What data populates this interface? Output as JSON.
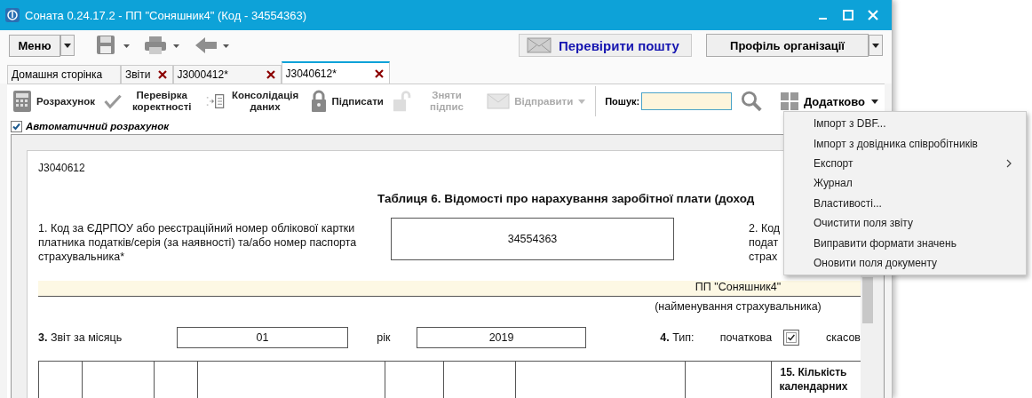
{
  "window": {
    "title": "Соната 0.24.17.2 - ПП \"Соняшник4\" (Код - 34554363)"
  },
  "toolbar": {
    "menu_button": "Меню",
    "mail_button": "Перевірити пошту",
    "profile_button": "Профіль організації"
  },
  "tabs": [
    {
      "label": "Домашня сторінка",
      "selected": false,
      "closable": false
    },
    {
      "label": "Звіти",
      "selected": false,
      "closable": true
    },
    {
      "label": "J3000412*",
      "selected": false,
      "closable": true
    },
    {
      "label": "J3040612*",
      "selected": true,
      "closable": true
    }
  ],
  "actions": [
    {
      "kind": "calc",
      "label": "Розрахунок",
      "disabled": false,
      "dropdown": false
    },
    {
      "kind": "check",
      "label": "Перевірка коректності",
      "disabled": false,
      "dropdown": false
    },
    {
      "kind": "consolidate",
      "label": "Консолідація даних",
      "disabled": false,
      "dropdown": false
    },
    {
      "kind": "sign",
      "label": "Підписати",
      "disabled": false,
      "dropdown": false
    },
    {
      "kind": "unsign",
      "label": "Зняти підпис",
      "disabled": true,
      "dropdown": false
    },
    {
      "kind": "send",
      "label": "Відправити",
      "disabled": true,
      "dropdown": true
    }
  ],
  "search": {
    "label": "Пошук:"
  },
  "more_button": "Додатково",
  "auto_calc": {
    "label": "Автоматичний розрахунок",
    "checked": true
  },
  "more_menu": [
    {
      "label": "Імпорт з DBF...",
      "submenu": false
    },
    {
      "label": "Імпорт з довідника співробітників",
      "submenu": false
    },
    {
      "label": "Експорт",
      "submenu": true
    },
    {
      "label": "Журнал",
      "submenu": false
    },
    {
      "label": "Властивості...",
      "submenu": false
    },
    {
      "label": "Очистити поля звіту",
      "submenu": false
    },
    {
      "label": "Виправити формати значень",
      "submenu": false
    },
    {
      "label": "Оновити поля документу",
      "submenu": false
    }
  ],
  "document": {
    "code": "J3040612",
    "title": "Таблиця 6. Відомості про нарахування заробітної плати (доход",
    "field_1_label": "1. Код за ЄДРПОУ або реєстраційний номер облікової картки платника податків/серія (за наявності) та/або номер паспорта страхувальника*",
    "field_1_value": "34554363",
    "field_2_label": [
      "2. Код",
      "подат",
      "страх"
    ],
    "insurer_name": "ПП \"Соняшник4\"",
    "insurer_caption": "(найменування страхувальника)",
    "month_label": "**3.** Звіт за місяць",
    "month": "01",
    "year_label": "рік",
    "year": "2019",
    "type_label": "**4.** Тип:",
    "type_initial": {
      "label": "початкова",
      "checked": true
    },
    "type_cancel": "скасов",
    "table_columns": [
      "",
      "",
      "",
      "",
      "",
      "",
      "",
      "",
      "15. Кількість календарних"
    ]
  }
}
